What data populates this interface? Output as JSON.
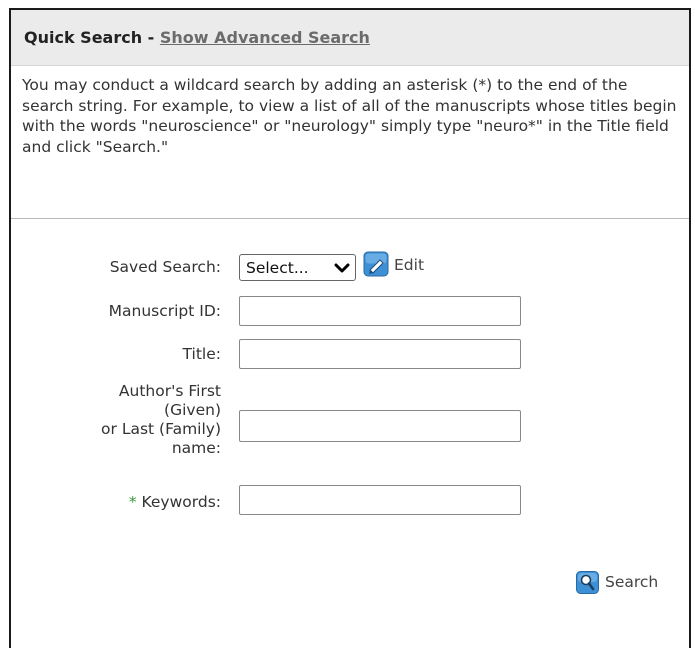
{
  "header": {
    "title": "Quick Search",
    "separator": " - ",
    "advanced_link": "Show Advanced Search"
  },
  "intro": {
    "text": "You may conduct a wildcard search by adding an asterisk (*) to the end of the search string. For example, to view a list of all of the manuscripts whose titles begin with the words \"neuroscience\" or \"neurology\" simply type \"neuro*\" in the Title field and click \"Search.\""
  },
  "form": {
    "saved_search": {
      "label": "Saved Search:",
      "selected": "Select...",
      "edit_label": "Edit"
    },
    "manuscript_id": {
      "label": "Manuscript ID:",
      "value": ""
    },
    "title": {
      "label": "Title:",
      "value": ""
    },
    "author": {
      "label_line1": "Author's First",
      "label_line2": "(Given)",
      "label_line3": "or Last (Family)",
      "label_line4": "name:",
      "value": ""
    },
    "keywords": {
      "required_marker": "*",
      "label": "Keywords:",
      "value": ""
    }
  },
  "actions": {
    "search_label": "Search"
  },
  "colors": {
    "header_bg": "#ebebeb",
    "required_marker": "#3a9a3a",
    "icon_blue": "#3d8fd6"
  },
  "icons": {
    "edit": "pencil-icon",
    "search": "magnifier-icon",
    "select_arrow": "chevron-down-icon"
  }
}
